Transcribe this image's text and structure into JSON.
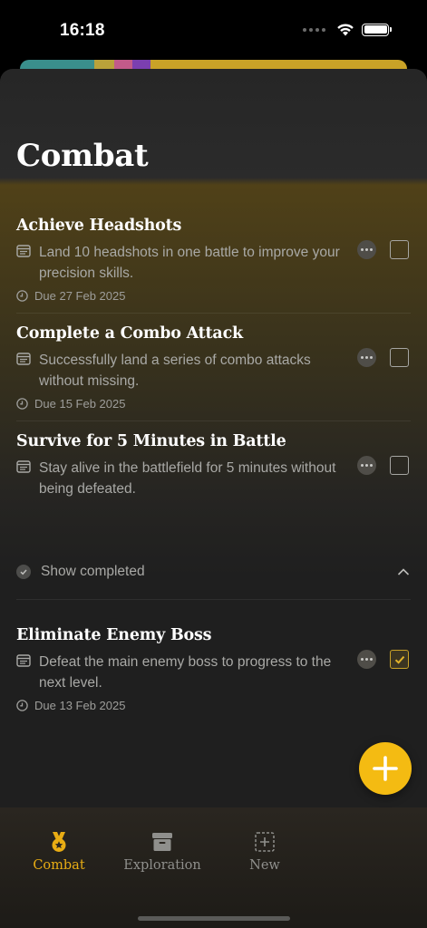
{
  "status_bar": {
    "time": "16:18"
  },
  "header": {
    "title": "Combat"
  },
  "tasks": [
    {
      "title": "Achieve Headshots",
      "description": "Land 10 headshots in one battle to improve your precision skills.",
      "due": "Due 27 Feb 2025",
      "completed": false
    },
    {
      "title": "Complete a Combo Attack",
      "description": "Successfully land a series of combo attacks without missing.",
      "due": "Due 15 Feb 2025",
      "completed": false
    },
    {
      "title": "Survive for 5 Minutes in Battle",
      "description": "Stay alive in the battlefield for 5 minutes without being defeated.",
      "due": "",
      "completed": false
    }
  ],
  "show_completed": {
    "label": "Show completed",
    "expanded": true
  },
  "completed_tasks": [
    {
      "title": "Eliminate Enemy Boss",
      "description": "Defeat the main enemy boss to progress to the next level.",
      "due": "Due 13 Feb 2025",
      "completed": true
    }
  ],
  "tab_bar": {
    "tabs": [
      {
        "label": "Combat",
        "icon": "medal-icon",
        "active": true
      },
      {
        "label": "Exploration",
        "icon": "archive-box-icon",
        "active": false
      },
      {
        "label": "New",
        "icon": "dashed-plus-square-icon",
        "active": false
      }
    ]
  },
  "colors": {
    "accent": "#f4bb12",
    "tab_active": "#e9ad14",
    "background": "#1f1f1f"
  },
  "behind_card_colors": [
    "#3a8f8c",
    "#b9a23a",
    "#c25a8a",
    "#7b3fb0",
    "#c9a227"
  ]
}
